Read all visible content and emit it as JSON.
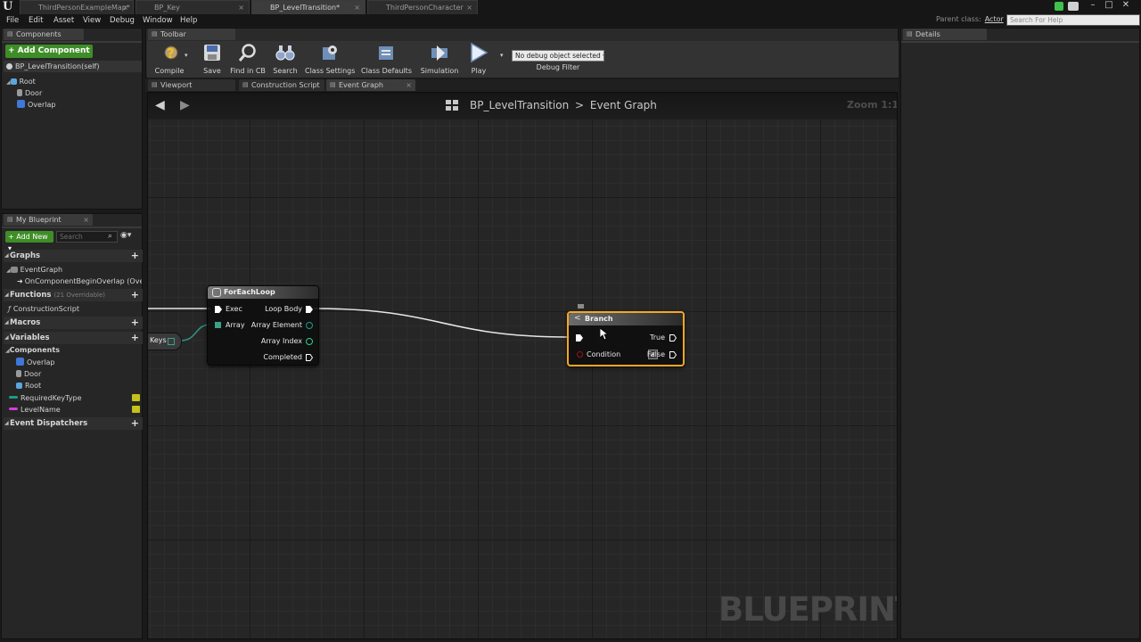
{
  "document_tabs": [
    {
      "label": "ThirdPersonExampleMap*",
      "active": false
    },
    {
      "label": "BP_Key",
      "active": false
    },
    {
      "label": "BP_LevelTransition*",
      "active": true
    },
    {
      "label": "ThirdPersonCharacter",
      "active": false
    }
  ],
  "menu": [
    "File",
    "Edit",
    "Asset",
    "View",
    "Debug",
    "Window",
    "Help"
  ],
  "parent_class": {
    "label": "Parent class:",
    "value": "Actor"
  },
  "help_search_placeholder": "Search For Help",
  "components_panel": {
    "tab": "Components",
    "add_button": "+ Add Component ▾",
    "self_item": "BP_LevelTransition(self)",
    "tree": [
      {
        "label": "Root",
        "depth": 0
      },
      {
        "label": "Door",
        "depth": 1
      },
      {
        "label": "Overlap",
        "depth": 1
      }
    ]
  },
  "my_blueprint_panel": {
    "tab": "My Blueprint",
    "add_button": "+ Add New ▾",
    "search_placeholder": "Search",
    "sections": {
      "graphs": "Graphs",
      "functions": "Functions",
      "functions_sub": "(21 Overridable)",
      "macros": "Macros",
      "variables": "Variables",
      "components": "Components",
      "dispatchers": "Event Dispatchers"
    },
    "graph_items": [
      "EventGraph",
      "OnComponentBeginOverlap (Ove"
    ],
    "function_items": [
      "ConstructionScript"
    ],
    "component_vars": [
      "Overlap",
      "Door",
      "Root"
    ],
    "variables": [
      "RequiredKeyType",
      "LevelName"
    ]
  },
  "toolbar": {
    "tab": "Toolbar",
    "buttons": [
      "Compile",
      "Save",
      "Find in CB",
      "Search",
      "Class Settings",
      "Class Defaults",
      "Simulation",
      "Play"
    ],
    "debug_select": "No debug object selected ▾",
    "debug_filter": "Debug Filter"
  },
  "editor_tabs": [
    "Viewport",
    "Construction Script",
    "Event Graph"
  ],
  "graph": {
    "breadcrumb_bp": "BP_LevelTransition",
    "breadcrumb_sep": ">",
    "breadcrumb_graph": "Event Graph",
    "zoom": "Zoom 1:1",
    "watermark": "BLUEPRINT",
    "keys_label": "Keys",
    "foreach": {
      "title": "ForEachLoop",
      "inputs": [
        "Exec",
        "Array"
      ],
      "outputs": [
        "Loop Body",
        "Array Element",
        "Array Index",
        "Completed"
      ]
    },
    "branch": {
      "title": "Branch",
      "outputs": [
        "True",
        "False"
      ],
      "condition": "Condition"
    }
  },
  "details_panel": {
    "tab": "Details"
  },
  "colors": {
    "accent_green": "#3e8e27",
    "selection_orange": "#f5a623",
    "array_pin_teal": "#3aa08a",
    "bool_pin_red": "#9a1414",
    "string_var_magenta": "#d63ce0",
    "struct_var_teal": "#1f9a8a"
  }
}
